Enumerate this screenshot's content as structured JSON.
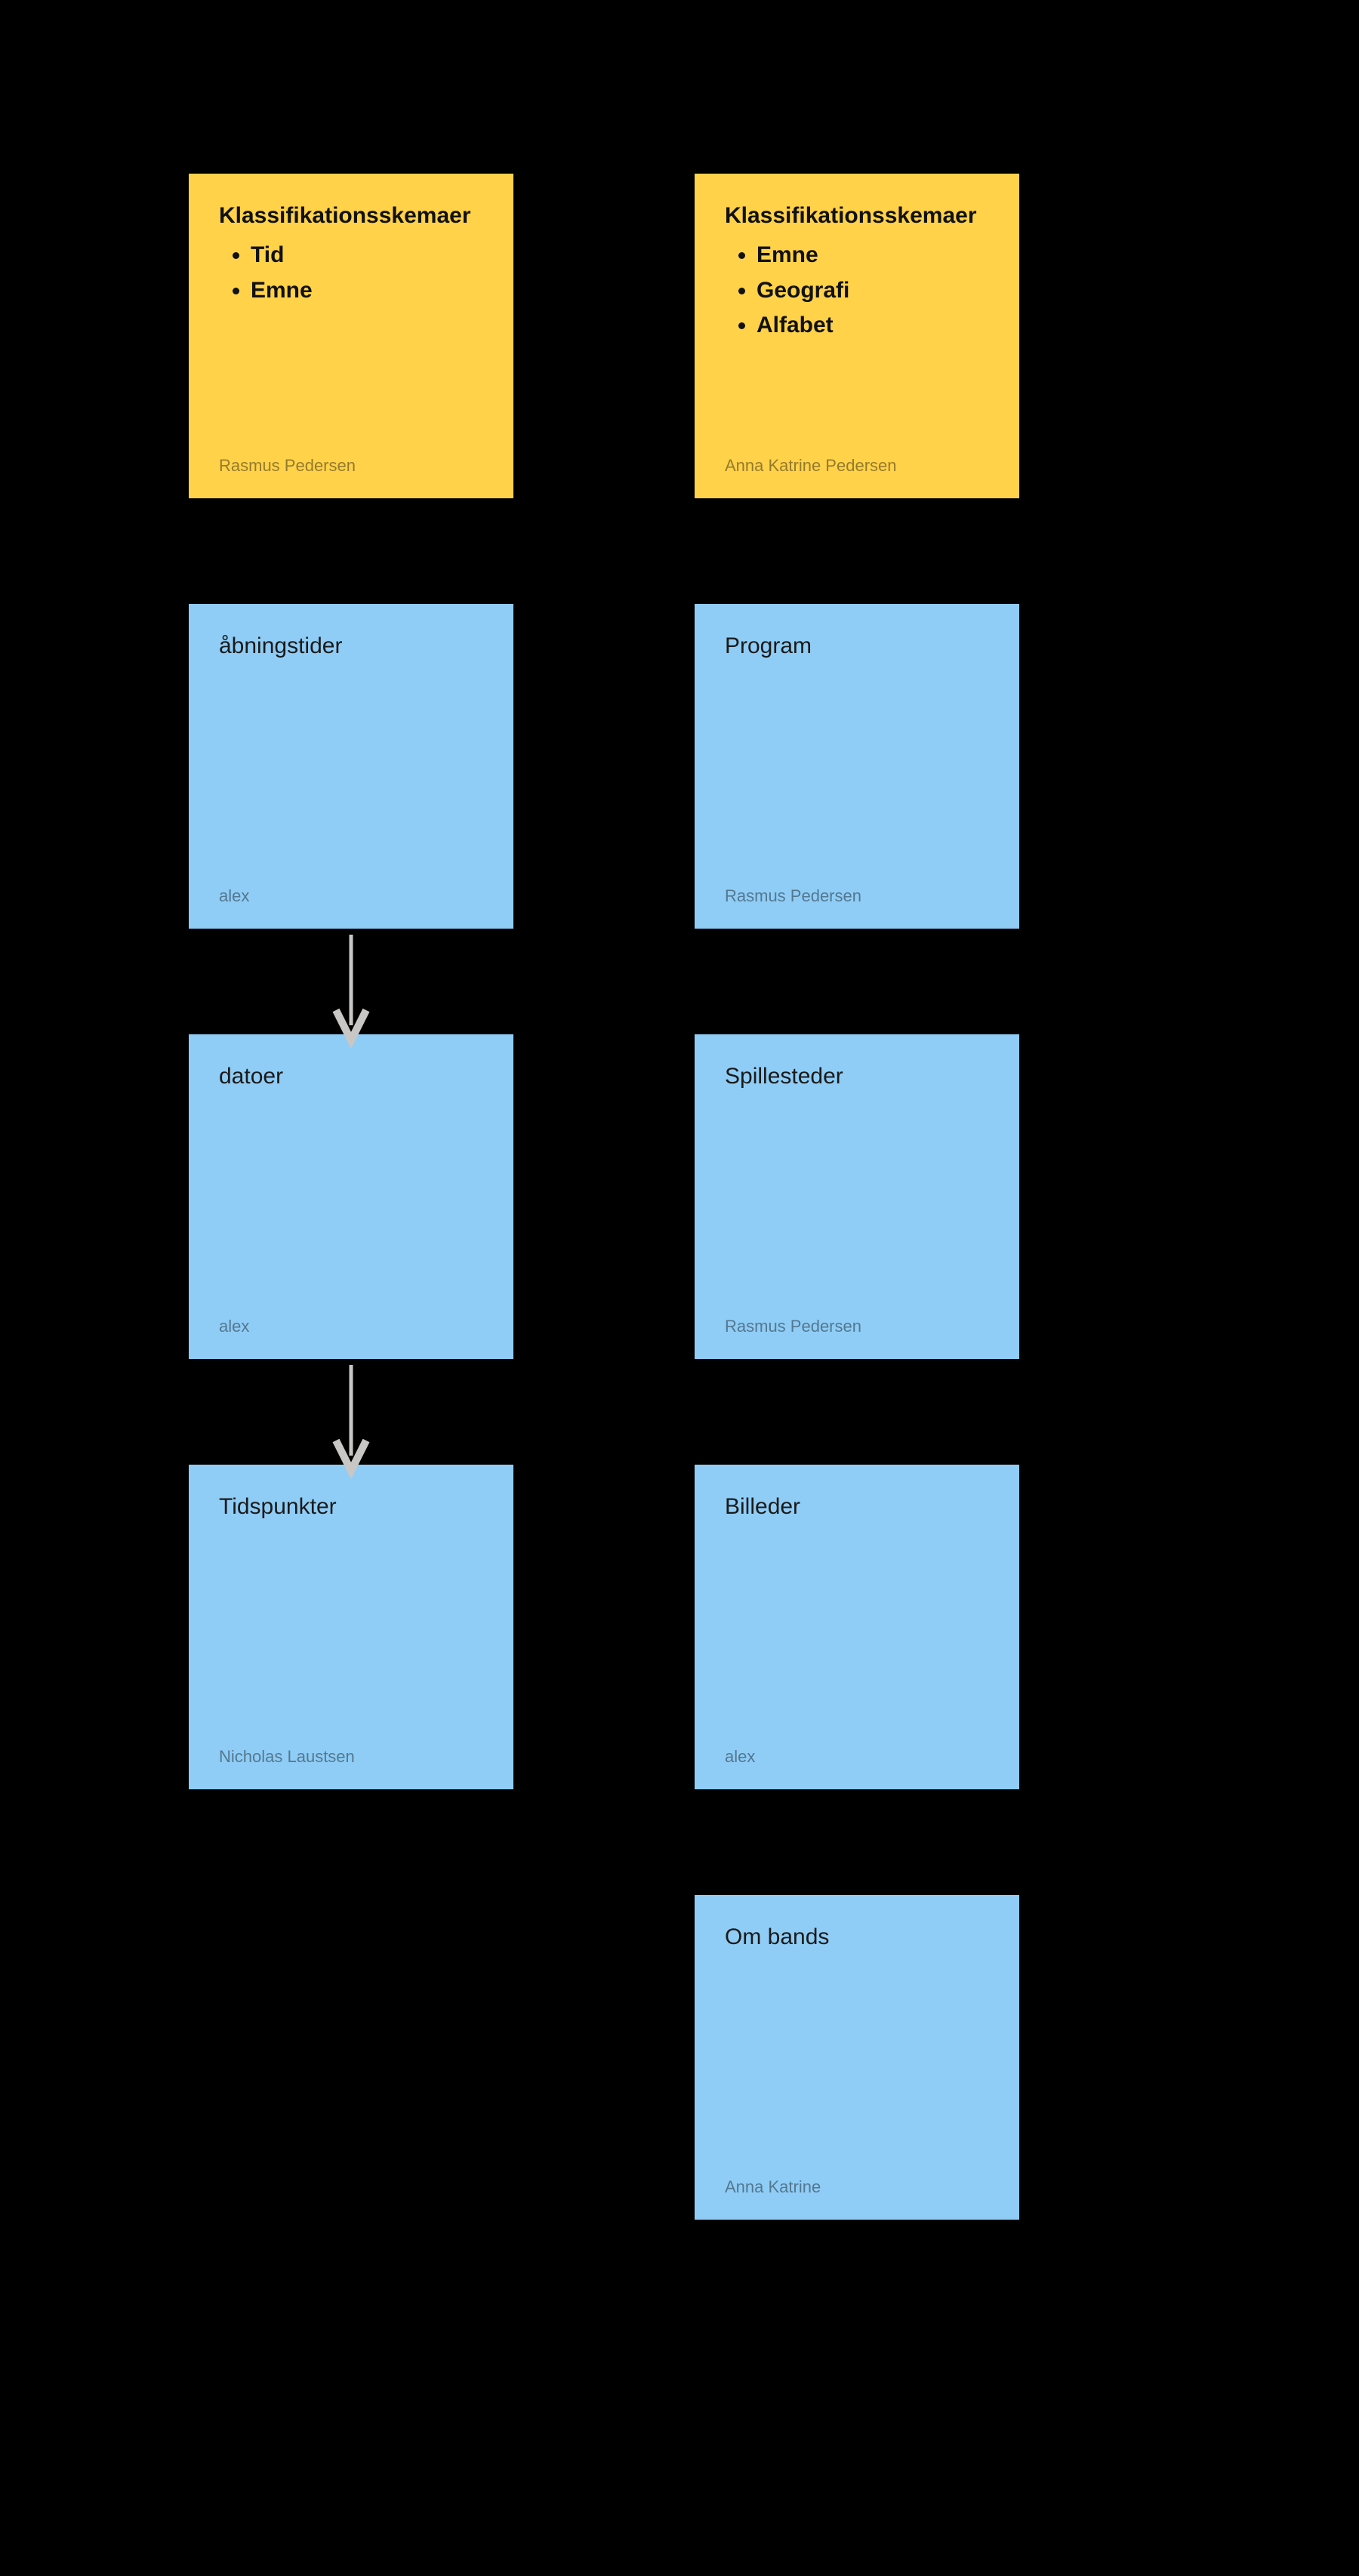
{
  "columns": {
    "left": {
      "header": {
        "title": "Klassifikationsskemaer",
        "bullets": [
          "Tid",
          "Emne"
        ],
        "author": "Rasmus Pedersen",
        "color": "yellow"
      },
      "notes": [
        {
          "title": "åbningstider",
          "author": "alex",
          "color": "blue"
        },
        {
          "title": "datoer",
          "author": "alex",
          "color": "blue"
        },
        {
          "title": "Tidspunkter",
          "author": "Nicholas Laustsen",
          "color": "blue"
        }
      ]
    },
    "right": {
      "header": {
        "title": "Klassifikationsskemaer",
        "bullets": [
          "Emne",
          "Geografi",
          "Alfabet"
        ],
        "author": "Anna Katrine Pedersen",
        "color": "yellow"
      },
      "notes": [
        {
          "title": "Program",
          "author": "Rasmus Pedersen",
          "color": "blue"
        },
        {
          "title": "Spillesteder",
          "author": "Rasmus Pedersen",
          "color": "blue"
        },
        {
          "title": "Billeder",
          "author": "alex",
          "color": "blue"
        },
        {
          "title": "Om bands",
          "author": "Anna Katrine",
          "color": "blue"
        }
      ]
    }
  },
  "connectors": [
    {
      "from": "left-note-0",
      "to": "left-note-1"
    },
    {
      "from": "left-note-1",
      "to": "left-note-2"
    }
  ],
  "layout": {
    "leftX": 250,
    "rightX": 920,
    "startY": 230,
    "gapY": 570
  }
}
